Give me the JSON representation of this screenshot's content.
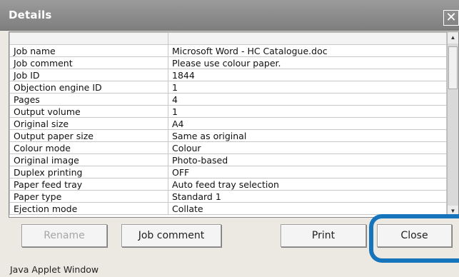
{
  "window": {
    "title": "Details",
    "close_glyph": "✕",
    "status_text": "Java Applet Window"
  },
  "details_table": {
    "rows": [
      {
        "label": "Job name",
        "value": "Microsoft Word - HC  Catalogue.doc"
      },
      {
        "label": "Job comment",
        "value": "Please use colour paper."
      },
      {
        "label": "Job ID",
        "value": "1844"
      },
      {
        "label": "Objection engine ID",
        "value": "1"
      },
      {
        "label": "Pages",
        "value": "4"
      },
      {
        "label": "Output volume",
        "value": "1"
      },
      {
        "label": "Original size",
        "value": "A4"
      },
      {
        "label": "Output paper size",
        "value": "Same as original"
      },
      {
        "label": "Colour mode",
        "value": "Colour"
      },
      {
        "label": "Original image",
        "value": "Photo-based"
      },
      {
        "label": "Duplex printing",
        "value": "OFF"
      },
      {
        "label": "Paper feed tray",
        "value": "Auto feed tray selection"
      },
      {
        "label": "Paper type",
        "value": "Standard 1"
      },
      {
        "label": "Ejection mode",
        "value": "Collate"
      }
    ]
  },
  "buttons": {
    "rename": "Rename",
    "job_comment": "Job comment",
    "print": "Print",
    "close": "Close"
  },
  "colors": {
    "highlight": "#1674bd",
    "titlebar": "#8a8a8a"
  },
  "scrollbar": {
    "up_glyph": "▲",
    "down_glyph": "▼"
  }
}
